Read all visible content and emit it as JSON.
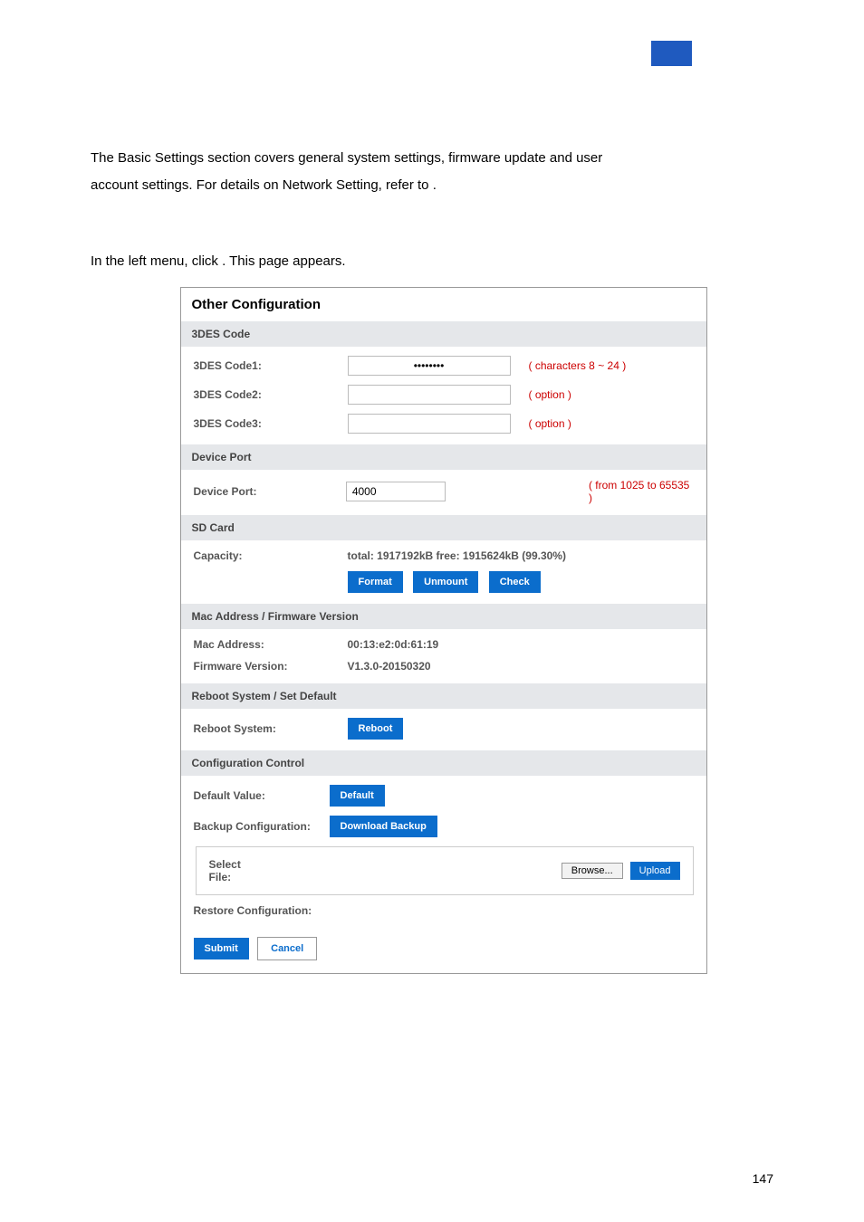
{
  "paragraph": {
    "line1": "The Basic Settings section covers general system settings, firmware update and user",
    "line2a": "account settings. For details on Network Setting, refer to ",
    "line2b": "."
  },
  "instruction": {
    "a": "In the left menu, click ",
    "b": ". This page appears."
  },
  "panel_title": "Other Configuration",
  "sections": {
    "s1": "3DES Code",
    "s2": "Device Port",
    "s3": "SD Card",
    "s4": "Mac Address / Firmware Version",
    "s5": "Reboot System / Set Default",
    "s6": "Configuration Control"
  },
  "des": {
    "l1": "3DES Code1:",
    "l2": "3DES Code2:",
    "l3": "3DES Code3:",
    "v1": "••••••••",
    "n1": "( characters 8 ~ 24 )",
    "n2": "( option )",
    "n3": "( option )"
  },
  "port": {
    "label": "Device Port:",
    "value": "4000",
    "note": "( from 1025 to 65535 )"
  },
  "sd": {
    "label": "Capacity:",
    "info": "total: 1917192kB free: 1915624kB (99.30%)",
    "b1": "Format",
    "b2": "Unmount",
    "b3": "Check"
  },
  "mac": {
    "l1": "Mac Address:",
    "v1": "00:13:e2:0d:61:19",
    "l2": "Firmware Version:",
    "v2": "V1.3.0-20150320"
  },
  "reboot": {
    "label": "Reboot System:",
    "btn": "Reboot"
  },
  "cfg": {
    "l1": "Default Value:",
    "b1": "Default",
    "l2": "Backup Configuration:",
    "b2": "Download Backup",
    "nested_lbl": "Select File:",
    "browse": "Browse...",
    "upload": "Upload",
    "l3": "Restore Configuration:"
  },
  "submit": "Submit",
  "cancel": "Cancel",
  "pagenum": "147"
}
